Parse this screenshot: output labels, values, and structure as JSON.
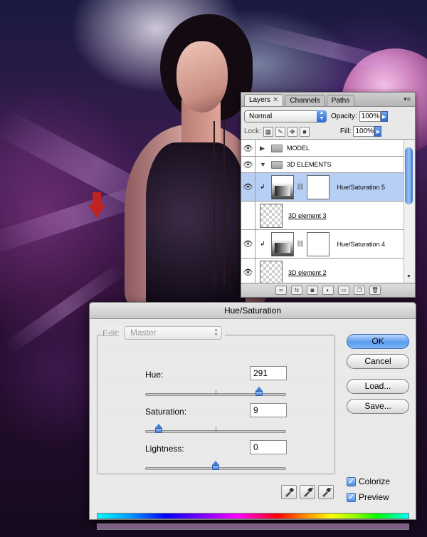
{
  "layers_panel": {
    "tabs": [
      {
        "label": "Layers",
        "active": true
      },
      {
        "label": "Channels",
        "active": false
      },
      {
        "label": "Paths",
        "active": false
      }
    ],
    "blend_mode": "Normal",
    "opacity_label": "Opacity:",
    "opacity_value": "100%",
    "lock_label": "Lock:",
    "fill_label": "Fill:",
    "fill_value": "100%",
    "layers": [
      {
        "name": "MODEL",
        "type": "group",
        "expanded": false
      },
      {
        "name": "3D ELEMENTS",
        "type": "group",
        "expanded": true
      },
      {
        "name": "Hue/Saturation 5",
        "type": "adjustment",
        "selected": true
      },
      {
        "name": "3D element 3",
        "type": "pixel"
      },
      {
        "name": "Hue/Saturation 4",
        "type": "adjustment"
      },
      {
        "name": "3D element 2",
        "type": "pixel"
      }
    ]
  },
  "dialog": {
    "title": "Hue/Saturation",
    "edit_label": "Edit:",
    "edit_value": "Master",
    "hue": {
      "label": "Hue:",
      "value": "291",
      "fraction": 0.81
    },
    "saturation": {
      "label": "Saturation:",
      "value": "9",
      "fraction": 0.09
    },
    "lightness": {
      "label": "Lightness:",
      "value": "0",
      "fraction": 0.5
    },
    "buttons": {
      "ok": "OK",
      "cancel": "Cancel",
      "load": "Load...",
      "save": "Save..."
    },
    "colorize_label": "Colorize",
    "colorize_checked": true,
    "preview_label": "Preview",
    "preview_checked": true,
    "result_color": "#7e5e86"
  },
  "colors": {
    "accent": "#3d7fd9",
    "selected_row": "#b8cff5",
    "arrow": "#c0231e"
  }
}
